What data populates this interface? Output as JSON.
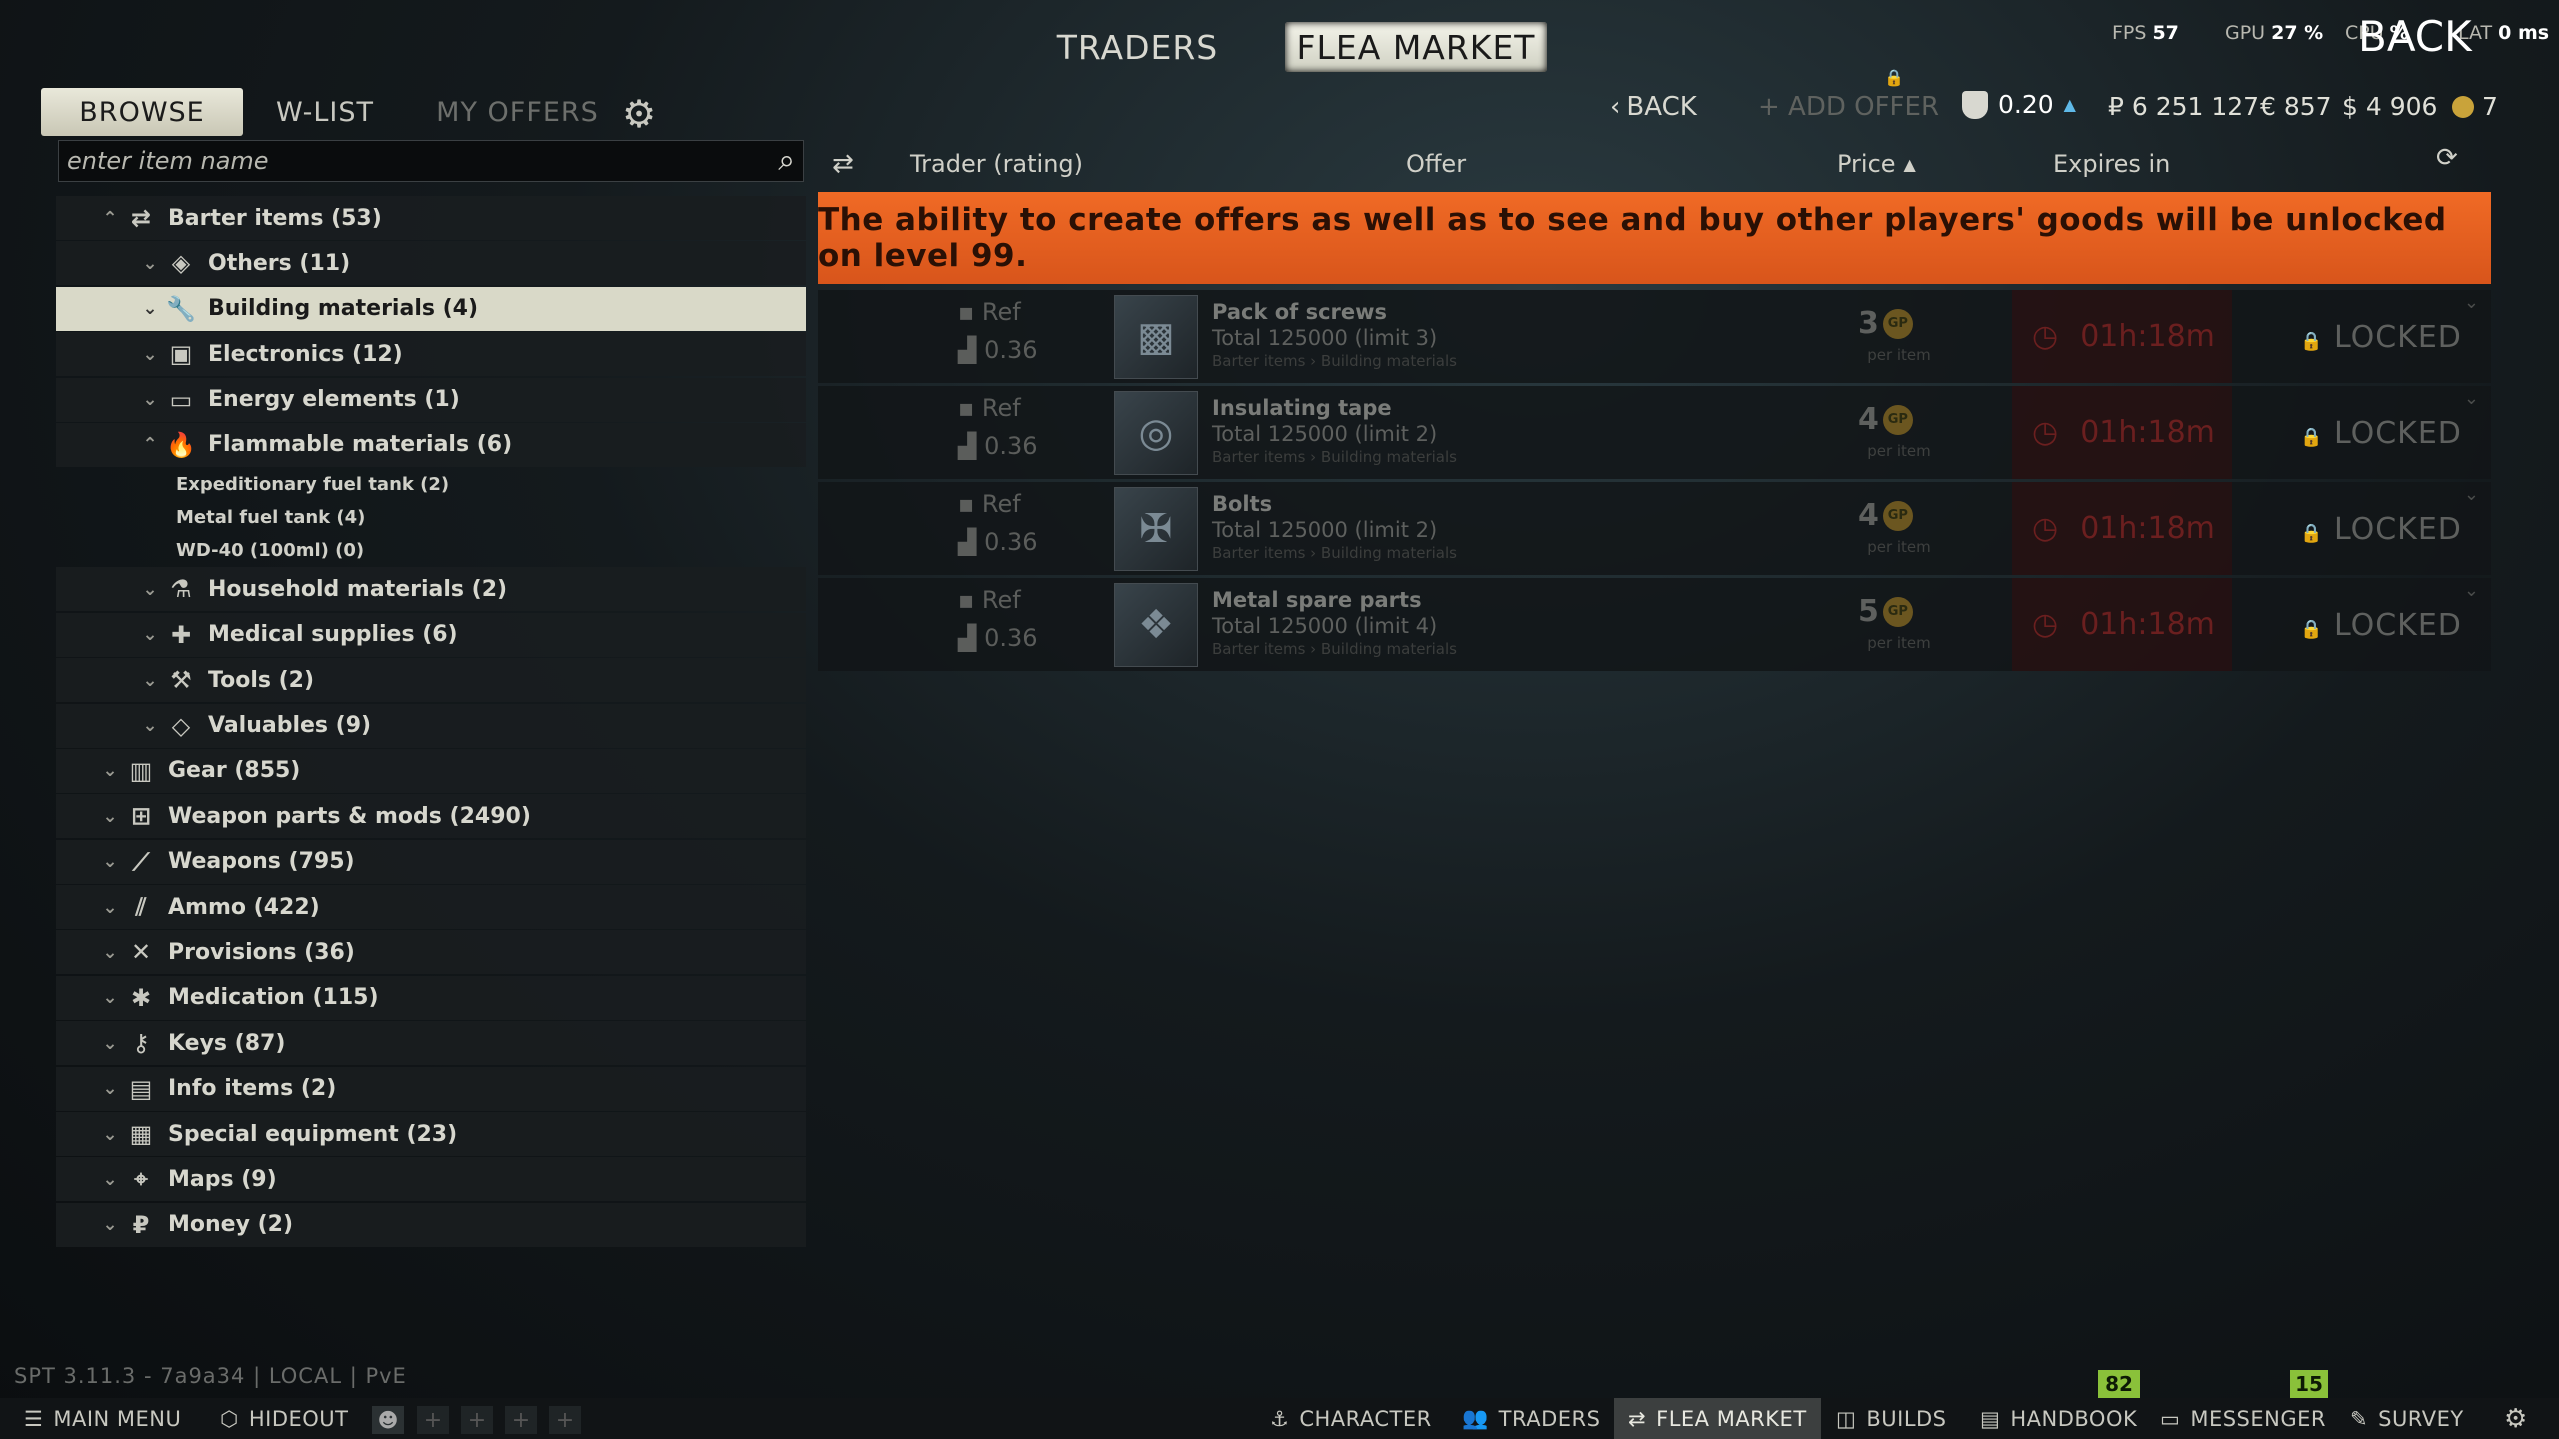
{
  "top_nav": {
    "traders": "TRADERS",
    "flea_market": "FLEA MARKET",
    "back_overlay": "BACK"
  },
  "perf": {
    "fps_label": "FPS",
    "fps": "57",
    "gpu_label": "GPU",
    "gpu": "27 %",
    "cpu_label": "CPU",
    "cpu": "%",
    "lat_label": "LAT",
    "lat": "0 ms"
  },
  "sub_tabs": {
    "browse": "BROWSE",
    "wlist": "W-LIST",
    "my_offers": "MY OFFERS"
  },
  "toolbar": {
    "back": "BACK",
    "add_offer": "+ ADD OFFER",
    "rating": "0.20",
    "roubles": "₽ 6 251 127",
    "euros": "€ 857",
    "dollars": "$ 4 906",
    "gp": "7"
  },
  "search": {
    "placeholder": "enter item name"
  },
  "categories": [
    {
      "label": "Barter items (53)",
      "icon": "barter-icon"
    },
    {
      "label": "Others (11)",
      "icon": "layers-icon"
    },
    {
      "label": "Building materials (4)",
      "icon": "wrench-icon"
    },
    {
      "label": "Electronics (12)",
      "icon": "chip-icon"
    },
    {
      "label": "Energy elements (1)",
      "icon": "battery-icon"
    },
    {
      "label": "Flammable materials (6)",
      "icon": "flame-icon"
    },
    {
      "label": "Household materials (2)",
      "icon": "bottle-icon"
    },
    {
      "label": "Medical supplies (6)",
      "icon": "pill-icon"
    },
    {
      "label": "Tools (2)",
      "icon": "tools-icon"
    },
    {
      "label": "Valuables (9)",
      "icon": "gem-icon"
    },
    {
      "label": "Gear (855)",
      "icon": "vest-icon"
    },
    {
      "label": "Weapon parts & mods (2490)",
      "icon": "mod-icon"
    },
    {
      "label": "Weapons (795)",
      "icon": "rifle-icon"
    },
    {
      "label": "Ammo (422)",
      "icon": "ammo-icon"
    },
    {
      "label": "Provisions (36)",
      "icon": "cutlery-icon"
    },
    {
      "label": "Medication (115)",
      "icon": "medication-icon"
    },
    {
      "label": "Keys (87)",
      "icon": "key-icon"
    },
    {
      "label": "Info items (2)",
      "icon": "book-icon"
    },
    {
      "label": "Special equipment (23)",
      "icon": "device-icon"
    },
    {
      "label": "Maps (9)",
      "icon": "map-icon"
    },
    {
      "label": "Money (2)",
      "icon": "rouble-icon"
    }
  ],
  "flammable_children": [
    "Expeditionary fuel tank (2)",
    "Metal fuel tank (4)",
    "WD-40 (100ml) (0)"
  ],
  "table_headers": {
    "trader": "Trader (rating)",
    "offer": "Offer",
    "price": "Price",
    "expires": "Expires in"
  },
  "banner": "The ability to create offers as well as to see and buy other players' goods will be unlocked on level 99.",
  "offers": [
    {
      "ref": "Ref",
      "rating": "0.36",
      "name": "Pack of screws",
      "total": "Total 125000  (limit 3)",
      "path": "Barter items › Building materials",
      "price": "3",
      "per": "per item",
      "expires": "01h:18m",
      "status": "LOCKED"
    },
    {
      "ref": "Ref",
      "rating": "0.36",
      "name": "Insulating tape",
      "total": "Total 125000  (limit 2)",
      "path": "Barter items › Building materials",
      "price": "4",
      "per": "per item",
      "expires": "01h:18m",
      "status": "LOCKED"
    },
    {
      "ref": "Ref",
      "rating": "0.36",
      "name": "Bolts",
      "total": "Total 125000  (limit 2)",
      "path": "Barter items › Building materials",
      "price": "4",
      "per": "per item",
      "expires": "01h:18m",
      "status": "LOCKED"
    },
    {
      "ref": "Ref",
      "rating": "0.36",
      "name": "Metal spare parts",
      "total": "Total 125000  (limit 4)",
      "path": "Barter items › Building materials",
      "price": "5",
      "per": "per item",
      "expires": "01h:18m",
      "status": "LOCKED"
    }
  ],
  "version": "SPT 3.11.3 - 7a9a34 | LOCAL | PvE",
  "bottom_nav": {
    "main_menu": "MAIN MENU",
    "hideout": "HIDEOUT",
    "character": "CHARACTER",
    "traders": "TRADERS",
    "flea_market": "FLEA MARKET",
    "builds": "BUILDS",
    "handbook": "HANDBOOK",
    "messenger": "MESSENGER",
    "survey": "SURVEY"
  },
  "badges": {
    "handbook": "82",
    "messenger": "15"
  },
  "colors": {
    "banner": "#e8601f",
    "selected_row": "#d9d9c8",
    "badge": "#8ac13a",
    "expires": "#6b1f1f"
  }
}
